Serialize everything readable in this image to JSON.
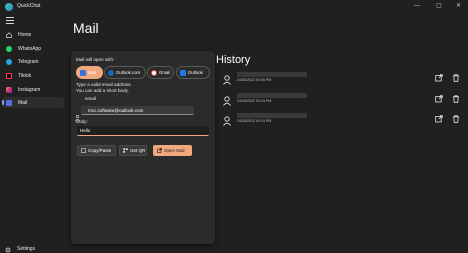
{
  "app": {
    "title": "QuickChat"
  },
  "window": {
    "minimize": "—",
    "maximize": "▢",
    "close": "✕"
  },
  "sidebar": {
    "items": [
      {
        "label": "Home",
        "icon": "home-icon"
      },
      {
        "label": "WhatsApp",
        "icon": "whatsapp-icon"
      },
      {
        "label": "Telegram",
        "icon": "telegram-icon"
      },
      {
        "label": "Tiktok",
        "icon": "tiktok-icon"
      },
      {
        "label": "Instagram",
        "icon": "instagram-icon"
      },
      {
        "label": "Mail",
        "icon": "mail-icon"
      }
    ],
    "settings_label": "Settings"
  },
  "page": {
    "title": "Mail"
  },
  "mail": {
    "open_with_label": "Mail will open with:",
    "clients": [
      {
        "label": "Mail",
        "selected": true
      },
      {
        "label": "Outlook.com",
        "selected": false
      },
      {
        "label": "Gmail",
        "selected": false
      },
      {
        "label": "Outlook",
        "selected": false
      }
    ],
    "hint_line1": "Type a valid email address.",
    "hint_line2": "You can add a short body.",
    "email_label": "email",
    "email_value": "mcc.software@outlook.com",
    "body_label": "Body:",
    "body_value": "Hello",
    "copy_paste_label": "Copy/Paste",
    "get_qr_label": "Get QR",
    "open_mail_label": "Open Mail"
  },
  "history": {
    "title": "History",
    "items": [
      {
        "timestamp": "24/05/2022 00:06 PM"
      },
      {
        "timestamp": "24/05/2022 00:24 PM"
      },
      {
        "timestamp": "24/05/2022 00:24 PM"
      }
    ]
  },
  "colors": {
    "accent": "#f0a87e",
    "background": "#202020",
    "card": "#2b2b2b"
  }
}
